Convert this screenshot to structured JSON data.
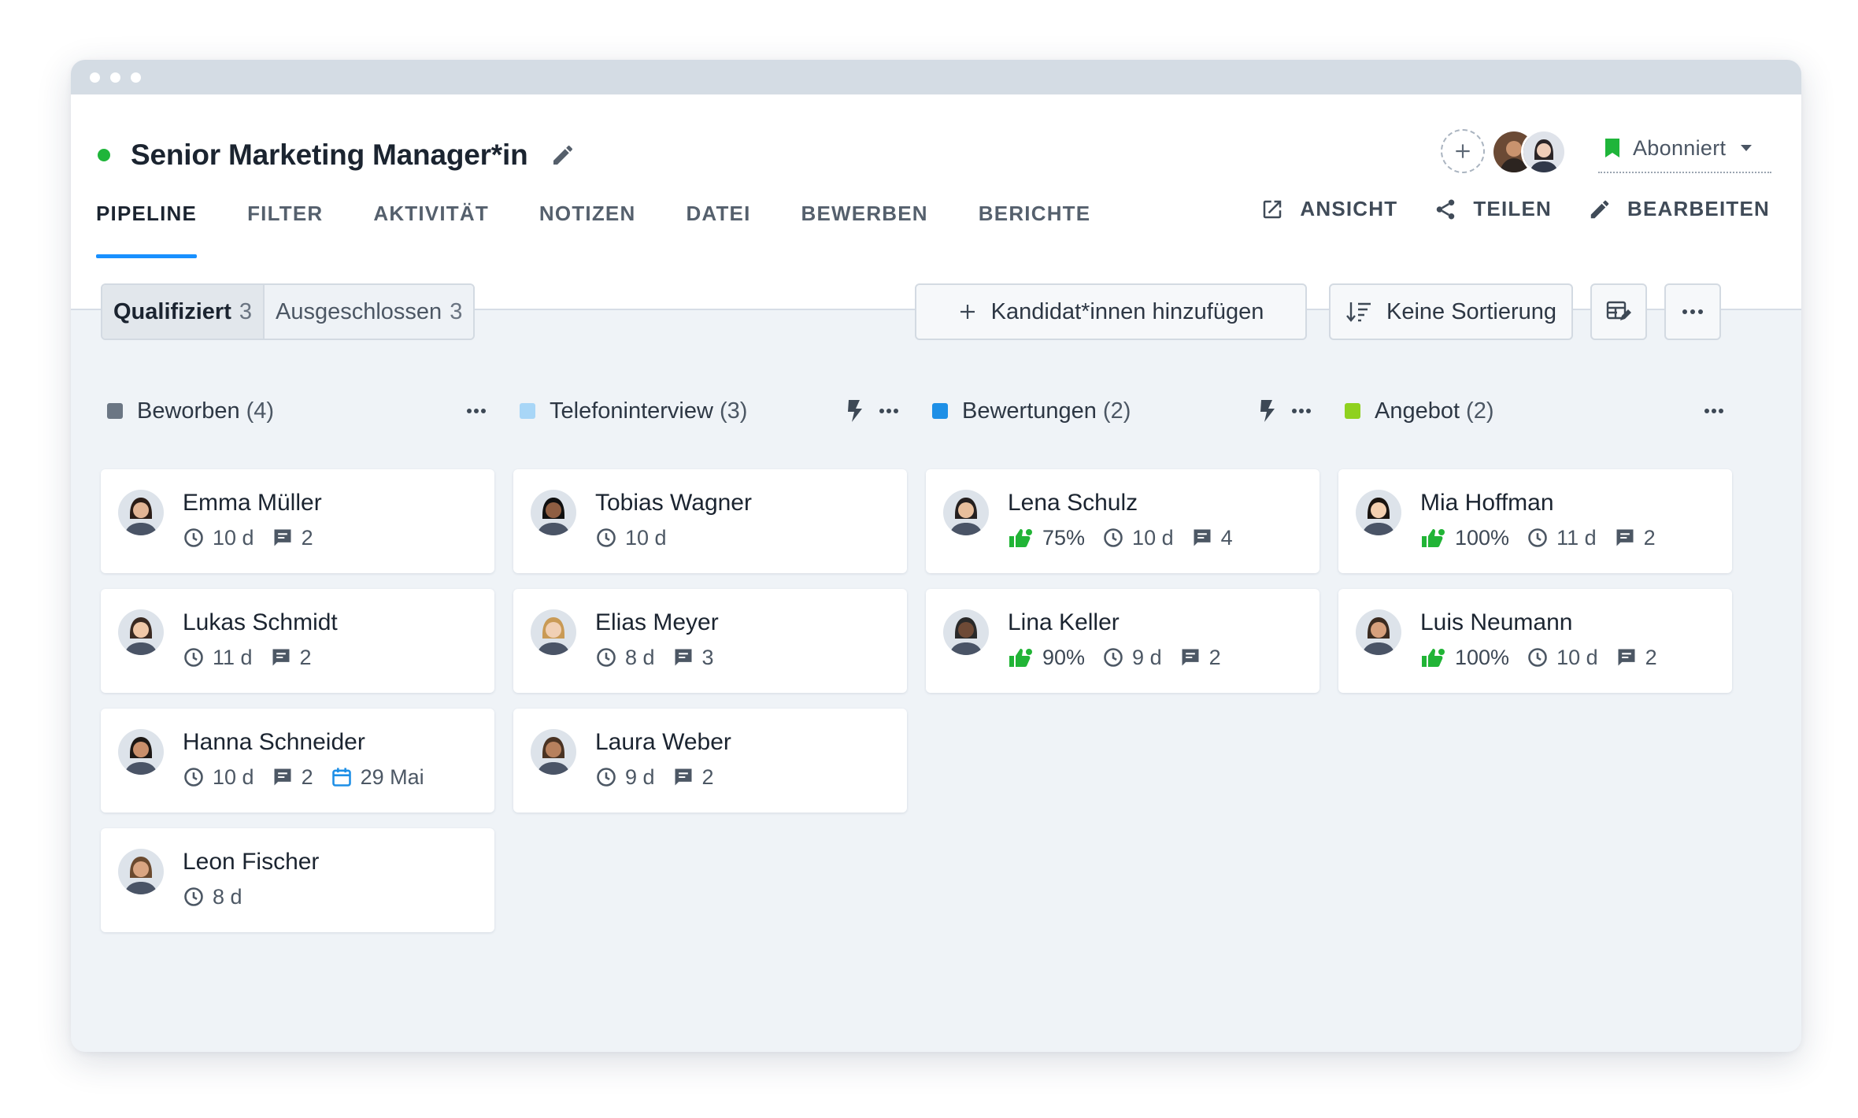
{
  "job": {
    "title": "Senior Marketing Manager*in",
    "status_color": "#1fb53a"
  },
  "subscribe": {
    "label": "Abonniert"
  },
  "tabs": [
    "PIPELINE",
    "FILTER",
    "AKTIVITÄT",
    "NOTIZEN",
    "DATEI",
    "BEWERBEN",
    "BERICHTE"
  ],
  "actions": {
    "view": "ANSICHT",
    "share": "TEILEN",
    "edit": "BEARBEITEN"
  },
  "toolbar": {
    "qualified_label": "Qualifiziert",
    "qualified_count": "3",
    "excluded_label": "Ausgeschlossen",
    "excluded_count": "3",
    "add_candidates": "Kandidat*innen hinzufügen",
    "sort": "Keine Sortierung"
  },
  "colors": {
    "accent": "#1890ff",
    "score_green": "#21b436"
  },
  "columns": [
    {
      "name": "Beworben",
      "count": "(4)",
      "color": "#6b7684",
      "cards": [
        {
          "name": "Emma Müller",
          "days": "10 d",
          "comments": "2"
        },
        {
          "name": "Lukas Schmidt",
          "days": "11 d",
          "comments": "2"
        },
        {
          "name": "Hanna Schneider",
          "days": "10 d",
          "comments": "2",
          "date": "29 Mai"
        },
        {
          "name": "Leon Fischer",
          "days": "8 d"
        }
      ]
    },
    {
      "name": "Telefoninterview",
      "count": "(3)",
      "color": "#a8d6f7",
      "cards": [
        {
          "name": "Tobias Wagner",
          "days": "10 d"
        },
        {
          "name": "Elias Meyer",
          "days": "8 d",
          "comments": "3"
        },
        {
          "name": "Laura Weber",
          "days": "9 d",
          "comments": "2"
        }
      ]
    },
    {
      "name": "Bewertungen",
      "count": "(2)",
      "color": "#1e8fe6",
      "cards": [
        {
          "name": "Lena Schulz",
          "score": "75%",
          "days": "10 d",
          "comments": "4"
        },
        {
          "name": "Lina Keller",
          "score": "90%",
          "days": "9 d",
          "comments": "2"
        }
      ]
    },
    {
      "name": "Angebot",
      "count": "(2)",
      "color": "#8fd11f",
      "cards": [
        {
          "name": "Mia Hoffman",
          "score": "100%",
          "days": "11 d",
          "comments": "2"
        },
        {
          "name": "Luis Neumann",
          "score": "100%",
          "days": "10 d",
          "comments": "2"
        }
      ]
    }
  ]
}
